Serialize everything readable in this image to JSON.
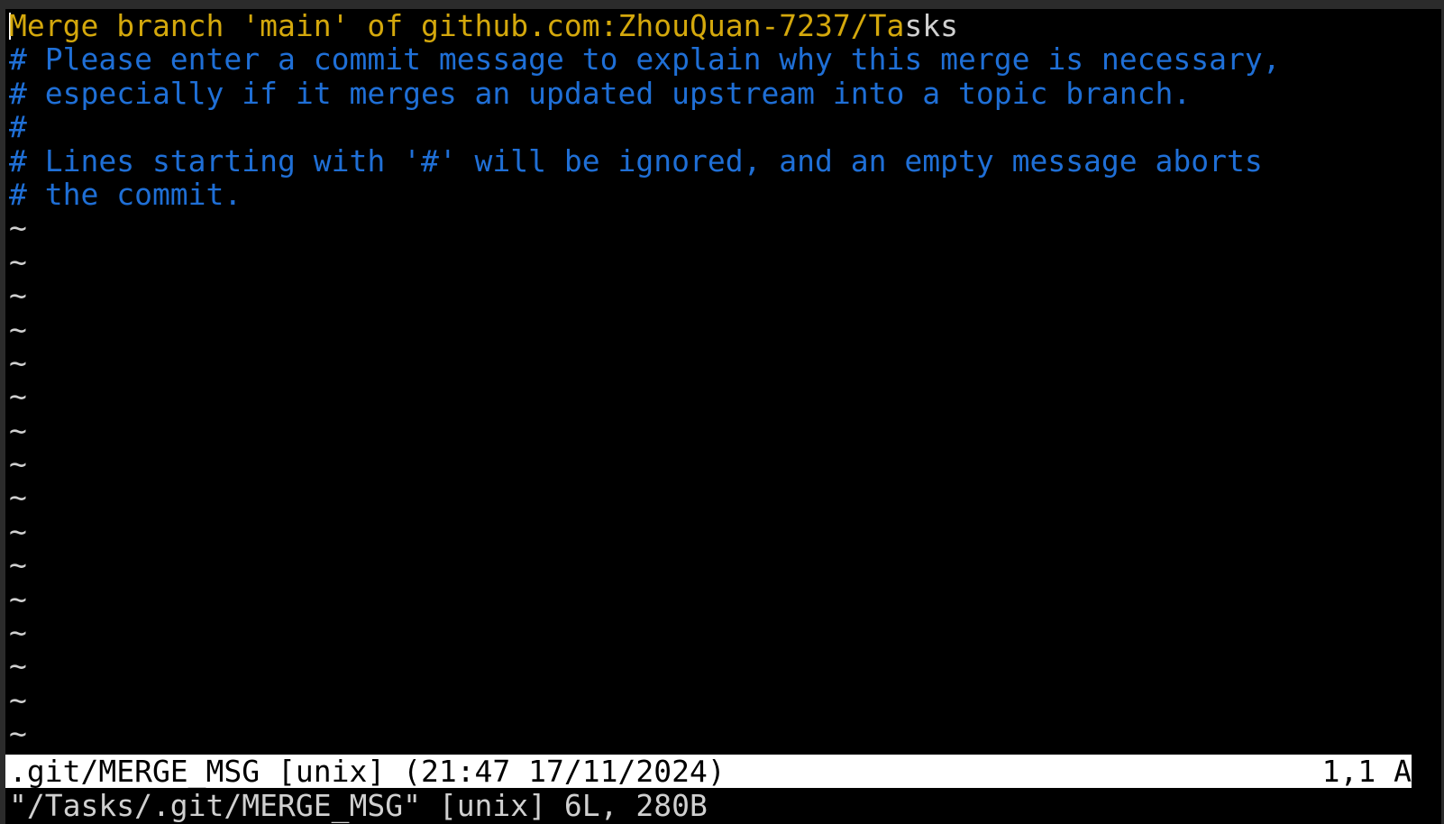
{
  "buffer": {
    "merge_line_prefix": "Merge branch 'main' of github.com:ZhouQuan-7237/Ta",
    "merge_line_suffix": "sks",
    "comments": [
      "# Please enter a commit message to explain why this merge is necessary,",
      "# especially if it merges an updated upstream into a topic branch.",
      "#",
      "# Lines starting with '#' will be ignored, and an empty message aborts",
      "# the commit."
    ],
    "tilde": "~"
  },
  "status": {
    "file": ".git/MERGE_MSG [unix] (21:47 17/11/2024)",
    "position": "1,1 A"
  },
  "cmdline": {
    "text": "\"/Tasks/.git/MERGE_MSG\" [unix] 6L, 280B"
  },
  "colors": {
    "merge_text": "#d4a80c",
    "comment_text": "#1f6fd6",
    "background": "#000000",
    "status_bg": "#ffffff"
  }
}
